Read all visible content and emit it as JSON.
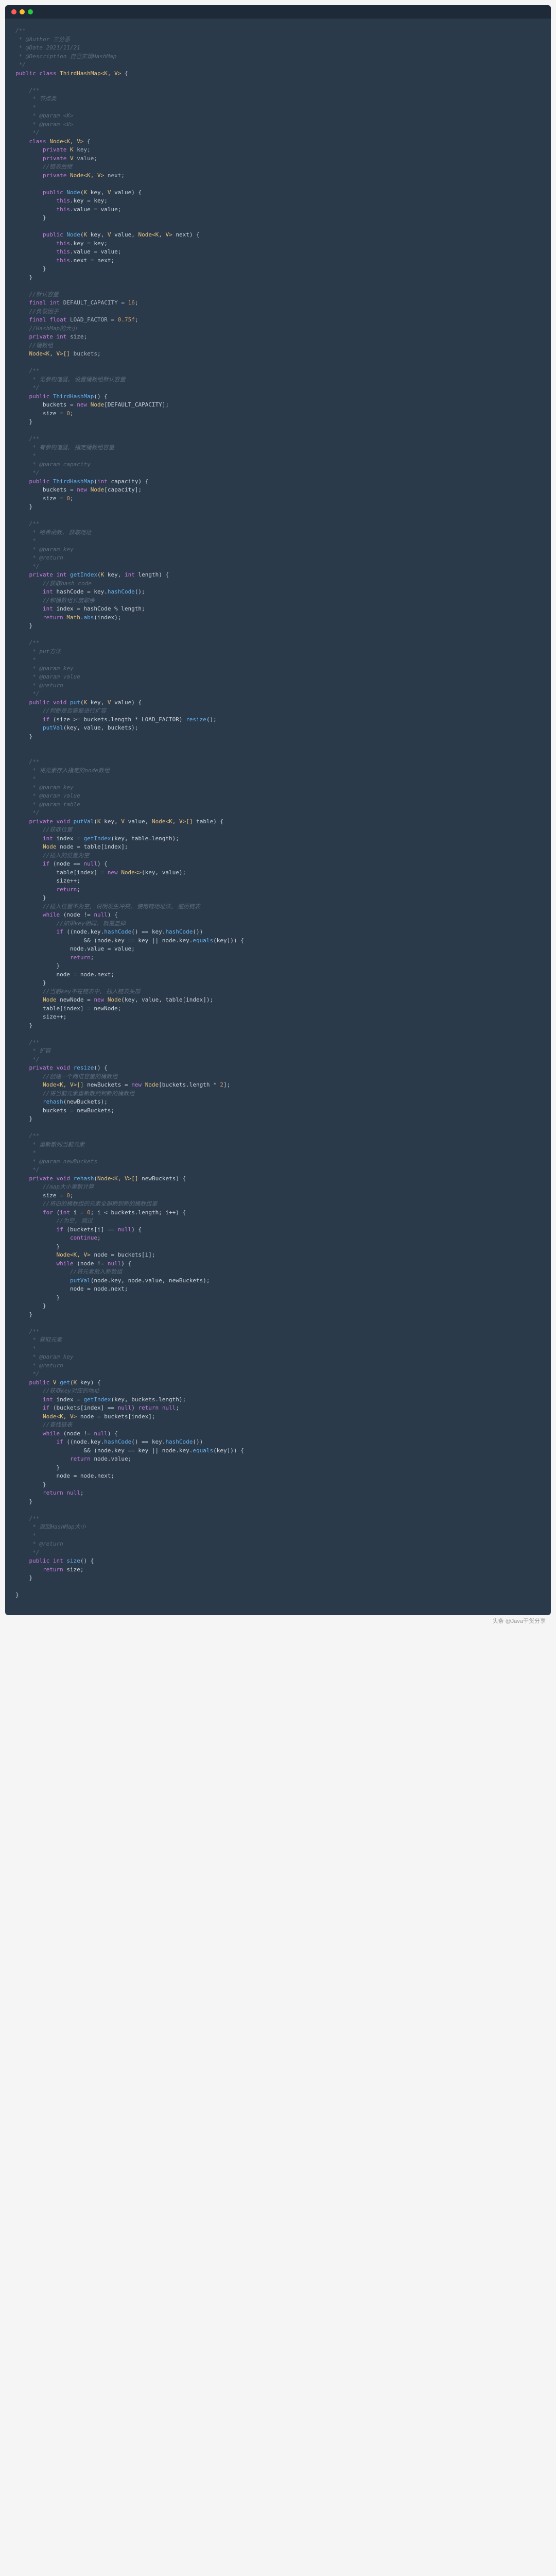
{
  "titlebar": {
    "dots": [
      "close",
      "minimize",
      "maximize"
    ]
  },
  "watermark": "头条 @Java干货分享",
  "code": {
    "header_comment": {
      "l1": "/**",
      "l2": " * @Author 三分恶",
      "l3": " * @Date 2021/11/21",
      "l4": " * @Description 自己实现HashMap",
      "l5": " */"
    },
    "class_decl": {
      "kw_public": "public",
      "kw_class": "class",
      "name": "ThirdHashMap",
      "generics": "<K, V>",
      "brace": " {"
    },
    "node_comment": {
      "l1": "/**",
      "l2": " * 节点类",
      "l3": " *",
      "l4": " * @param <K>",
      "l5": " * @param <V>",
      "l6": " */"
    },
    "node_class": {
      "decl": "class Node<K, V> {",
      "f1_kw": "private",
      "f1_t": "K",
      "f1_n": "key;",
      "f2_kw": "private",
      "f2_t": "V",
      "f2_n": "value;",
      "c1": "//链表后继",
      "f3_kw": "private",
      "f3_t": "Node<K, V>",
      "f3_n": "next;",
      "ctor1": "public Node(K key, V value) {",
      "ctor1_b1": "this.key = key;",
      "ctor1_b2": "this.value = value;",
      "ctor2": "public Node(K key, V value, Node<K, V> next) {",
      "ctor2_b1": "this.key = key;",
      "ctor2_b2": "this.value = value;",
      "ctor2_b3": "this.next = next;"
    },
    "fields": {
      "c1": "//默认容量",
      "f1": "final int DEFAULT_CAPACITY = 16;",
      "c2": "//负载因子",
      "f2": "final float LOAD_FACTOR = 0.75f;",
      "c3": "//HashMap的大小",
      "f3": "private int size;",
      "c4": "//桶数组",
      "f4": "Node<K, V>[] buckets;"
    },
    "ctor_noarg": {
      "c1": "/**",
      "c2": " * 无参构造器, 设置桶数组默认容量",
      "c3": " */",
      "decl": "public ThirdHashMap() {",
      "b1": "buckets = new Node[DEFAULT_CAPACITY];",
      "b2": "size = 0;"
    },
    "ctor_cap": {
      "c1": "/**",
      "c2": " * 有参构造器, 指定桶数组容量",
      "c3": " *",
      "c4": " * @param capacity",
      "c5": " */",
      "decl": "public ThirdHashMap(int capacity) {",
      "b1": "buckets = new Node[capacity];",
      "b2": "size = 0;"
    },
    "getIndex": {
      "c1": "/**",
      "c2": " * 哈希函数, 获取地址",
      "c3": " *",
      "c4": " * @param key",
      "c5": " * @return",
      "c6": " */",
      "decl": "private int getIndex(K key, int length) {",
      "cc1": "//获取hash code",
      "b1": "int hashCode = key.hashCode();",
      "cc2": "//和桶数组长度取余",
      "b2": "int index = hashCode % length;",
      "b3": "return Math.abs(index);"
    },
    "put": {
      "c1": "/**",
      "c2": " * put方法",
      "c3": " *",
      "c4": " * @param key",
      "c5": " * @param value",
      "c6": " * @return",
      "c7": " */",
      "decl": "public void put(K key, V value) {",
      "cc1": "//判断是否需要进行扩容",
      "b1": "if (size >= buckets.length * LOAD_FACTOR) resize();",
      "b2": "putVal(key, value, buckets);"
    },
    "putVal": {
      "c1": "/**",
      "c2": " * 将元素存入指定的node数组",
      "c3": " *",
      "c4": " * @param key",
      "c5": " * @param value",
      "c6": " * @param table",
      "c7": " */",
      "decl": "private void putVal(K key, V value, Node<K, V>[] table) {",
      "cc1": "//获取位置",
      "b1": "int index = getIndex(key, table.length);",
      "b2": "Node node = table[index];",
      "cc2": "//插入的位置为空",
      "b3": "if (node == null) {",
      "b4": "table[index] = new Node<>(key, value);",
      "b5": "size++;",
      "b6": "return;",
      "cc3": "//插入位置不为空, 说明发生冲突, 使用链地址法, 遍历链表",
      "b7": "while (node != null) {",
      "cc4": "//如果key相同, 就覆盖掉",
      "b8": "if ((node.key.hashCode() == key.hashCode())",
      "b9": "&& (node.key == key || node.key.equals(key))) {",
      "b10": "node.value = value;",
      "b11": "return;",
      "b12": "node = node.next;",
      "cc5": "//当前key不在链表中, 插入链表头部",
      "b13": "Node newNode = new Node(key, value, table[index]);",
      "b14": "table[index] = newNode;",
      "b15": "size++;"
    },
    "resize": {
      "c1": "/**",
      "c2": " * 扩容",
      "c3": " */",
      "decl": "private void resize() {",
      "cc1": "//创建一个两倍容量的桶数组",
      "b1": "Node<K, V>[] newBuckets = new Node[buckets.length * 2];",
      "cc2": "//将当前元素重新散列到新的桶数组",
      "b2": "rehash(newBuckets);",
      "b3": "buckets = newBuckets;"
    },
    "rehash": {
      "c1": "/**",
      "c2": " * 重新散列当前元素",
      "c3": " *",
      "c4": " * @param newBuckets",
      "c5": " */",
      "decl": "private void rehash(Node<K, V>[] newBuckets) {",
      "cc1": "//map大小重新计算",
      "b1": "size = 0;",
      "cc2": "//将旧的桶数组的元素全部刷到新的桶数组里",
      "b2": "for (int i = 0; i < buckets.length; i++) {",
      "cc3": "//为空, 跳过",
      "b3": "if (buckets[i] == null) {",
      "b4": "continue;",
      "b5": "Node<K, V> node = buckets[i];",
      "b6": "while (node != null) {",
      "cc4": "//将元素放入新数组",
      "b7": "putVal(node.key, node.value, newBuckets);",
      "b8": "node = node.next;"
    },
    "get": {
      "c1": "/**",
      "c2": " * 获取元素",
      "c3": " *",
      "c4": " * @param key",
      "c5": " * @return",
      "c6": " */",
      "decl": "public V get(K key) {",
      "cc1": "//获取key对应的地址",
      "b1": "int index = getIndex(key, buckets.length);",
      "b2": "if (buckets[index] == null) return null;",
      "b3": "Node<K, V> node = buckets[index];",
      "cc2": "//查找链表",
      "b4": "while (node != null) {",
      "b5": "if ((node.key.hashCode() == key.hashCode())",
      "b6": "&& (node.key == key || node.key.equals(key))) {",
      "b7": "return node.value;",
      "b8": "node = node.next;",
      "b9": "return null;"
    },
    "sizeMethod": {
      "c1": "/**",
      "c2": " * 返回HashMap大小",
      "c3": " *",
      "c4": " * @return",
      "c5": " */",
      "decl": "public int size() {",
      "b1": "return size;"
    }
  }
}
